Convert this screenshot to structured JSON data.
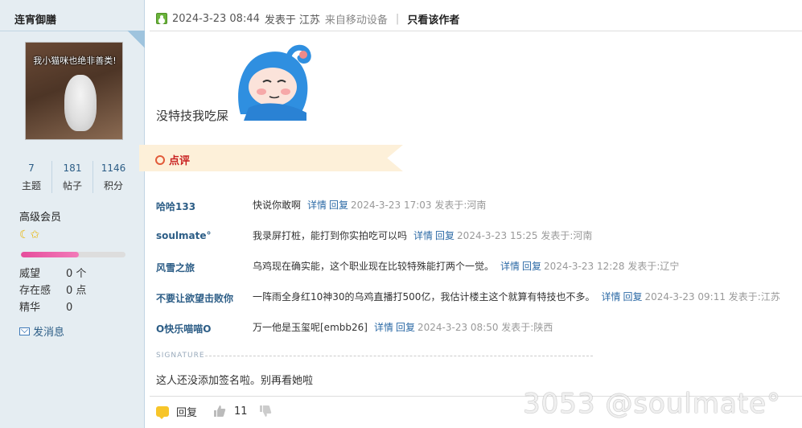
{
  "author": {
    "name": "连宵御膳",
    "avatar_caption": "我小猫咪也绝非善类!",
    "stats": [
      {
        "value": "7",
        "label": "主题"
      },
      {
        "value": "181",
        "label": "帖子"
      },
      {
        "value": "1146",
        "label": "积分"
      }
    ],
    "level": "高级会员",
    "level_icons": "☾✩",
    "reputation_fraction": 0.55,
    "properties": [
      {
        "key": "威望",
        "value": "0 个"
      },
      {
        "key": "存在感",
        "value": "0 点"
      },
      {
        "key": "精华",
        "value": "0"
      }
    ],
    "send_message": "发消息"
  },
  "post": {
    "datetime": "2024-3-23 08:44",
    "posted_in_label": "发表于",
    "location": "江苏",
    "source": "来自移动设备",
    "only_author": "只看该作者",
    "content": "没特技我吃屎",
    "comment_section_title": "点评",
    "comments": [
      {
        "author": "哈哈133",
        "text": "快说你敢啊",
        "detail": "详情",
        "reply": "回复",
        "time": "2024-3-23 17:03 发表于:河南"
      },
      {
        "author": "soulmate°",
        "text": "我录屏打桩，能打到你实拍吃可以吗",
        "detail": "详情",
        "reply": "回复",
        "time": "2024-3-23 15:25 发表于:河南"
      },
      {
        "author": "风雪之旅",
        "text": "乌鸡现在确实能，这个职业现在比较特殊能打两个一觉。",
        "detail": "详情",
        "reply": "回复",
        "time": "2024-3-23 12:28 发表于:辽宁"
      },
      {
        "author": "不要让欲望击败你",
        "text": "一阵雨全身红10神30的乌鸡直播打500亿，我估计楼主这个就算有特技也不多。",
        "detail": "详情",
        "reply": "回复",
        "time": "2024-3-23 09:11 发表于:江苏"
      },
      {
        "author": "O快乐喵喵O",
        "text": "万一他是玉玺呢[embb26]",
        "detail": "详情",
        "reply": "回复",
        "time": "2024-3-23 08:50 发表于:陕西"
      }
    ],
    "signature_label": "SIGNATURE",
    "signature": "这人还没添加签名啦。别再看她啦",
    "reply_label": "回复",
    "likes": "11"
  },
  "watermark": "3053 @soulmate°",
  "colors": {
    "sidebar_bg": "#e5edf2",
    "link": "#2c5d86",
    "comment_title": "#c81f1f",
    "banner": "#fdf0d9"
  }
}
